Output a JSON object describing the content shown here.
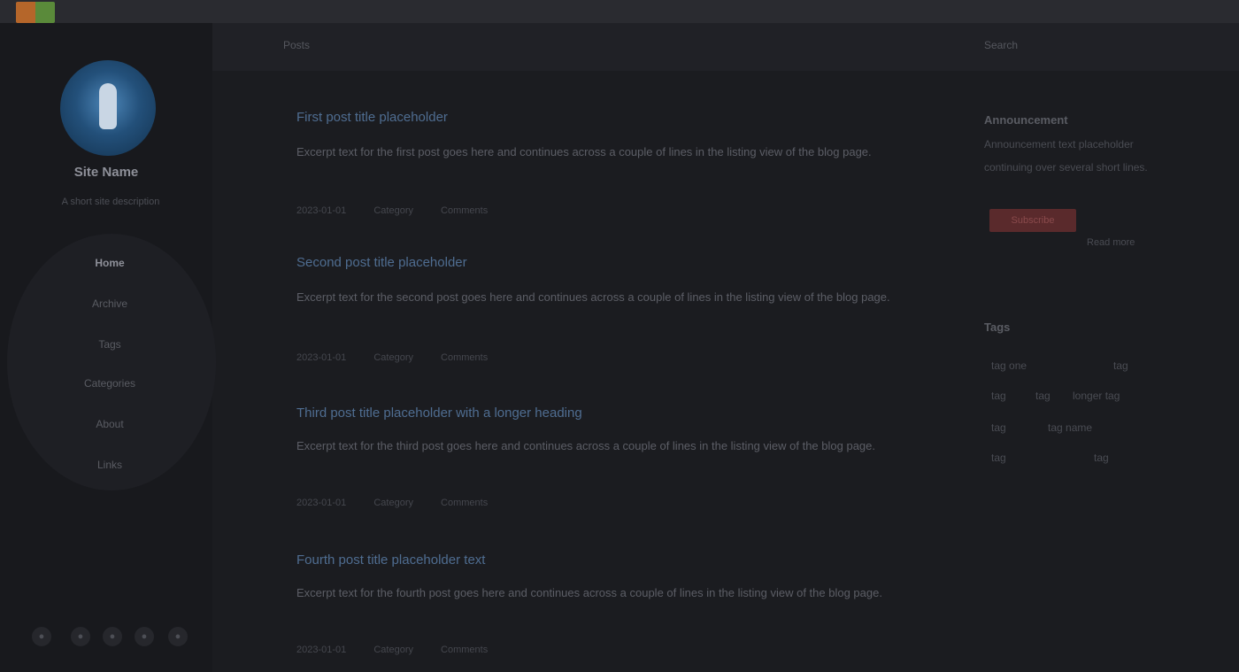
{
  "header": {
    "left": "Posts",
    "right": "Search"
  },
  "sidebar": {
    "site_name": "Site Name",
    "description": "A short site description",
    "nav": [
      "Home",
      "Archive",
      "Tags",
      "Categories",
      "About",
      "Links"
    ],
    "social": [
      "github",
      "twitter",
      "rss",
      "mail",
      "more"
    ]
  },
  "posts": [
    {
      "title": "First post title placeholder",
      "excerpt": "Excerpt text for the first post goes here and continues across a couple of lines in the listing view of the blog page.",
      "meta": [
        "2023-01-01",
        "Category",
        "Comments"
      ]
    },
    {
      "title": "Second post title placeholder",
      "excerpt": "Excerpt text for the second post goes here and continues across a couple of lines in the listing view of the blog page.",
      "meta": [
        "2023-01-01",
        "Category",
        "Comments"
      ]
    },
    {
      "title": "Third post title placeholder with a longer heading",
      "excerpt": "Excerpt text for the third post goes here and continues across a couple of lines in the listing view of the blog page.",
      "meta": [
        "2023-01-01",
        "Category",
        "Comments"
      ]
    },
    {
      "title": "Fourth post title placeholder text",
      "excerpt": "Excerpt text for the fourth post goes here and continues across a couple of lines in the listing view of the blog page.",
      "meta": [
        "2023-01-01",
        "Category",
        "Comments"
      ]
    }
  ],
  "widgets": {
    "announce_title": "Announcement",
    "announce_text": "Announcement text placeholder continuing over several short lines.",
    "announce_button": "Subscribe",
    "announce_link": "Read more",
    "tags_title": "Tags",
    "tags": [
      "tag one",
      "tag",
      "tag",
      "tag",
      "longer tag",
      "tag",
      "tag name",
      "tag",
      "tag"
    ]
  }
}
